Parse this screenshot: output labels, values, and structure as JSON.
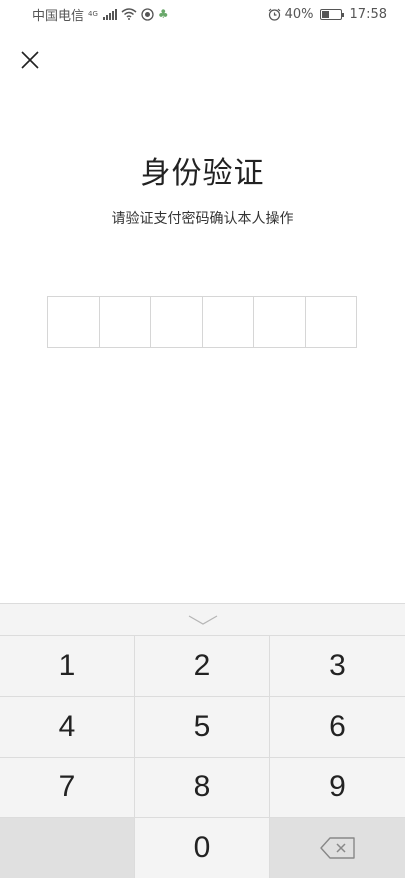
{
  "status_bar": {
    "carrier": "中国电信",
    "network_label": "4G",
    "battery_percent": "40%",
    "battery_level": 0.4,
    "time": "17:58"
  },
  "icons": {
    "close": "close-icon",
    "collapse": "chevron-down-icon",
    "backspace": "backspace-icon"
  },
  "page": {
    "title": "身份验证",
    "subtitle": "请验证支付密码确认本人操作"
  },
  "pin": {
    "length": 6,
    "filled": 0
  },
  "keypad": {
    "keys": [
      "1",
      "2",
      "3",
      "4",
      "5",
      "6",
      "7",
      "8",
      "9",
      "",
      "0",
      ""
    ]
  },
  "colors": {
    "background": "#ffffff",
    "keyboard_bg": "#f4f4f4",
    "key_dark_bg": "#e0e0e0",
    "border": "#dcdcdc",
    "text": "#222222"
  }
}
